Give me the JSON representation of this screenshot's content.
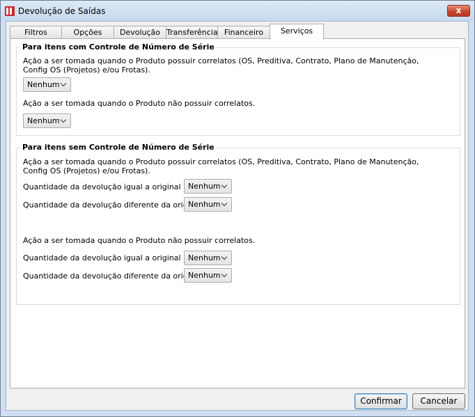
{
  "window": {
    "title": "Devolução de Saídas",
    "close_label": "x"
  },
  "tabs": [
    "Filtros",
    "Opções",
    "Devolução",
    "Transferência",
    "Financeiro",
    "Serviços"
  ],
  "active_tab": "Serviços",
  "group1": {
    "title": "Para itens com Controle de Número de Série",
    "action_with_line1": "Ação a ser tomada quando o Produto possuir correlatos (OS, Preditiva, Contrato, Plano de Manutenção,",
    "action_with_line2": "Config OS (Projetos) e/ou Frotas).",
    "combo_with": "Nenhum",
    "action_without": "Ação a ser tomada quando o Produto não possuir correlatos.",
    "combo_without": "Nenhum"
  },
  "group2": {
    "title": "Para itens sem Controle de Número de Série",
    "action_with_line1": "Ação a ser tomada quando o Produto possuir correlatos (OS, Preditiva, Contrato, Plano de Manutenção,",
    "action_with_line2": "Config OS (Projetos) e/ou Frotas).",
    "with_equal_label": "Quantidade da devolução igual a original",
    "with_equal_value": "Nenhum",
    "with_diff_label": "Quantidade da devolução diferente da original",
    "with_diff_value": "Nenhum",
    "action_without": "Ação a ser tomada quando o Produto não possuir correlatos.",
    "without_equal_label": "Quantidade da devolução igual a original",
    "without_equal_value": "Nenhum",
    "without_diff_label": "Quantidade da devolução diferente da original",
    "without_diff_value": "Nenhum"
  },
  "buttons": {
    "confirm": "Confirmar",
    "cancel": "Cancelar"
  }
}
